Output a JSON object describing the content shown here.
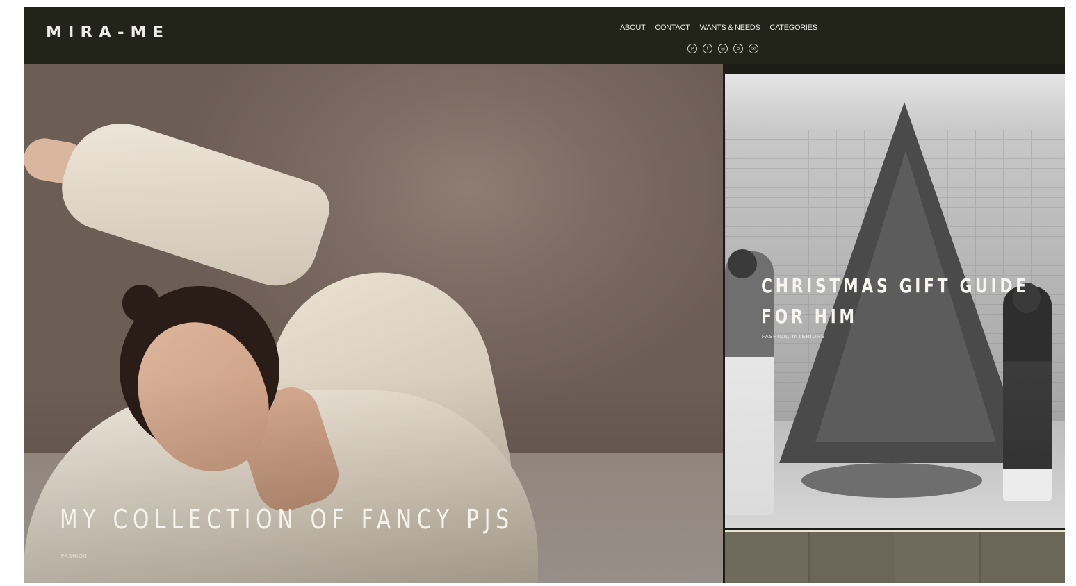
{
  "header": {
    "logo": "MIRA-ME",
    "nav": [
      "ABOUT",
      "CONTACT",
      "WANTS & NEEDS",
      "CATEGORIES"
    ],
    "social_icons": [
      "pinterest-icon",
      "facebook-icon",
      "instagram-icon",
      "bloglovin-icon",
      "email-icon"
    ]
  },
  "posts": [
    {
      "title": "MY COLLECTION OF FANCY PJS",
      "category": "FASHION"
    },
    {
      "title_line1": "CHRISTMAS GIFT GUIDE",
      "title_line2": "FOR HIM",
      "category": "FASHION, INTERIORS"
    }
  ],
  "colors": {
    "header_bg": "#22241a",
    "text_light": "#ecebe4"
  }
}
